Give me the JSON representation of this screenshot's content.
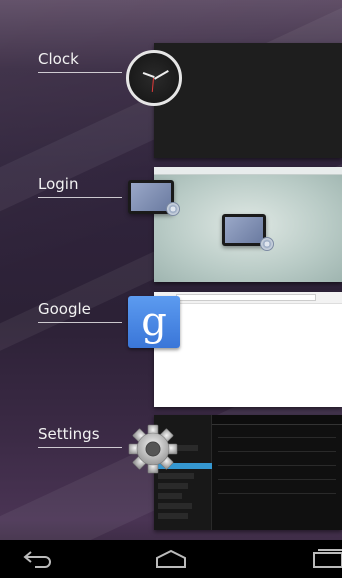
{
  "recents": [
    {
      "label": "Clock",
      "icon": "clock-icon"
    },
    {
      "label": "Login",
      "icon": "tablet-icon"
    },
    {
      "label": "Google",
      "icon": "google-search-icon",
      "glyph": "g"
    },
    {
      "label": "Settings",
      "icon": "gear-icon"
    }
  ],
  "navbar": {
    "back": "back-icon",
    "home": "home-icon",
    "recents": "recent-apps-icon"
  }
}
